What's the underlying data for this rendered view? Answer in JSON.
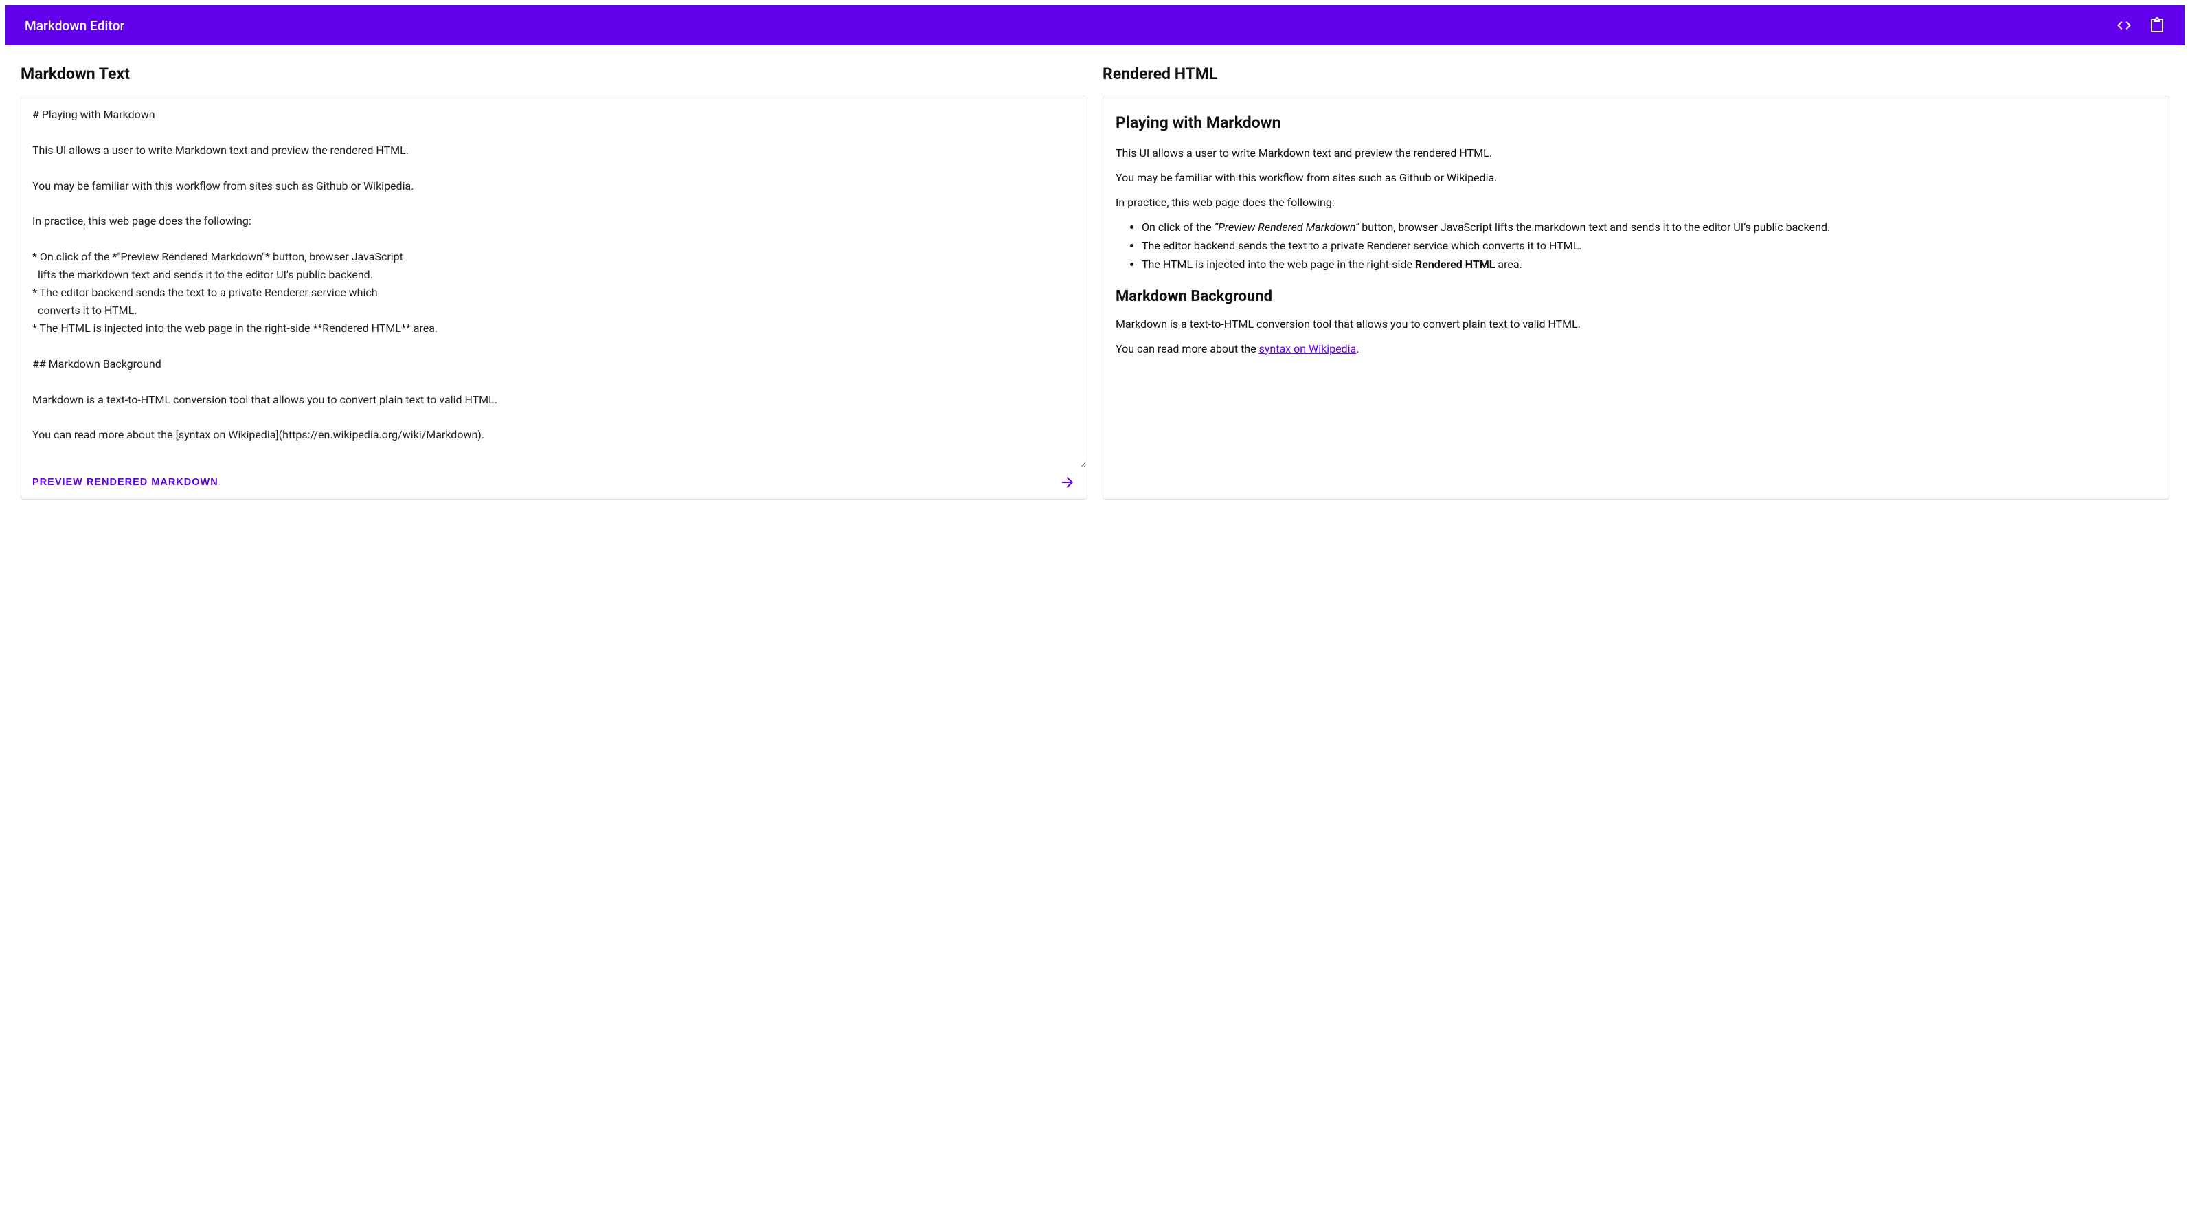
{
  "appbar": {
    "title": "Markdown Editor",
    "icons": {
      "code": "code-icon",
      "clipboard": "clipboard-icon"
    }
  },
  "editor": {
    "heading": "Markdown Text",
    "textarea_value": "# Playing with Markdown\n\nThis UI allows a user to write Markdown text and preview the rendered HTML.\n\nYou may be familiar with this workflow from sites such as Github or Wikipedia.\n\nIn practice, this web page does the following:\n\n* On click of the *\"Preview Rendered Markdown\"* button, browser JavaScript\n  lifts the markdown text and sends it to the editor UI's public backend.\n* The editor backend sends the text to a private Renderer service which\n  converts it to HTML.\n* The HTML is injected into the web page in the right-side **Rendered HTML** area.\n\n## Markdown Background\n\nMarkdown is a text-to-HTML conversion tool that allows you to convert plain text to valid HTML.\n\nYou can read more about the [syntax on Wikipedia](https://en.wikipedia.org/wiki/Markdown).",
    "preview_button_label": "Preview Rendered Markdown"
  },
  "rendered": {
    "heading": "Rendered HTML",
    "h1": "Playing with Markdown",
    "p1": "This UI allows a user to write Markdown text and preview the rendered HTML.",
    "p2": "You may be familiar with this workflow from sites such as Github or Wikipedia.",
    "p3": "In practice, this web page does the following:",
    "li1_a": "On click of the ",
    "li1_em": "“Preview Rendered Markdown”",
    "li1_b": " button, browser JavaScript lifts the markdown text and sends it to the editor UI’s public backend.",
    "li2": "The editor backend sends the text to a private Renderer service which converts it to HTML.",
    "li3_a": "The HTML is injected into the web page in the right-side ",
    "li3_strong": "Rendered HTML",
    "li3_b": " area.",
    "h2": "Markdown Background",
    "p4": "Markdown is a text-to-HTML conversion tool that allows you to convert plain text to valid HTML.",
    "p5_a": "You can read more about the ",
    "p5_link_text": "syntax on Wikipedia",
    "p5_link_href": "https://en.wikipedia.org/wiki/Markdown",
    "p5_b": "."
  }
}
